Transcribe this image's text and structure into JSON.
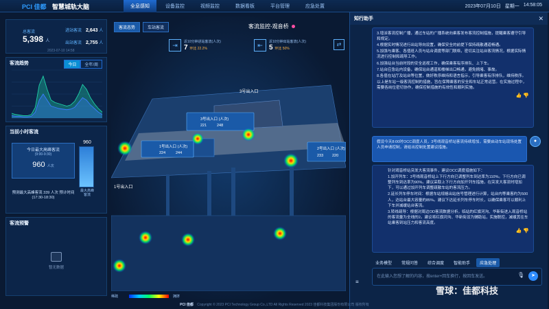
{
  "header": {
    "logo": "PCI 佳都",
    "title": "智慧城轨大脑",
    "nav": [
      "全息感知",
      "设备监控",
      "视频监控",
      "数据看板",
      "平台管理",
      "应急处置"
    ],
    "active_nav": 0,
    "datetime": "2023年07月10日",
    "weekday": "星期一",
    "time": "14:58:05"
  },
  "stats": {
    "total_label": "总客流",
    "total_value": "5,398",
    "total_unit": "人",
    "in_label": "进站客流",
    "in_value": "2,643",
    "in_unit": "人",
    "out_label": "出站客流",
    "out_value": "2,755",
    "out_unit": "人",
    "timestamp": "2023-07-10 14:58"
  },
  "trend": {
    "title": "客流趋势",
    "tab_today": "今日",
    "tab_all": "全年/周"
  },
  "peak": {
    "title": "当前小时客流",
    "box_title": "今日最大高峰客流",
    "box_time": "(9:00-9:30)",
    "value": "960",
    "unit": "人次",
    "note": "预测最大高峰客流 339 人次 预计时间(17:30-18:30)",
    "gauge_value": "960",
    "gauge_label": "最大高峰客流"
  },
  "warning": {
    "title": "客流预警",
    "empty_text": "暂无数据"
  },
  "center": {
    "btn_flow": "客流态势",
    "btn_station": "车站客流",
    "station_title": "客流监控-观音桥",
    "count1_label": "近10分钟进站客流(人次)",
    "count1_value": "7",
    "count1_change": "环比 22.2%",
    "count2_label": "近10分钟出站客流(人次)",
    "count2_value": "5",
    "count2_change": "环比 50%",
    "gate_labels": [
      "3号出入口",
      "1号出入口"
    ],
    "legend_low": "稀疏",
    "legend_high": "拥挤"
  },
  "gates": [
    {
      "title": "3号出入口 (人次)",
      "in": "221",
      "out": "248"
    },
    {
      "title": "1号出入口 (人次)",
      "in": "224",
      "out": "244"
    },
    {
      "title": "2号出入口 (人次)",
      "in": "233",
      "out": "220"
    }
  ],
  "assistant": {
    "name": "知行助手",
    "msg1": [
      "3.增派客流控制广播，通过车站的广播系统向乘客发布客流控制措施，提醒乘客遵守引导和规定。",
      "4.根据实时情况进行出站导向设置，确保安全的前提下保持疏散通道畅通。",
      "5.加强与乘客、各值班人员与站台调度等部门联络，密切关注站台客流情况，根据实际情况进行控制和疏导工作。",
      "6.加强站台当前时段的安全巡视工作，确保乘客有序排队、上下车。",
      "7.站台应急站内设备，确保站台通道和楼梯出口畅通，避免拥堵、事故。",
      "8.各值在站厅及站台等位置，做好秩序维持和语言指示，引导乘客有序排队，维持秩序。",
      "以上是车站一级客流控制的措施，旨在保障乘客的安全和车站正常运营。在实施过程中，需要各岗位密切协作，确保控制措施的有效性和顺利实施。"
    ],
    "msg2": "假设今天8:00时OCC调度人员，3号线观音桥站客流持续增加，需要启动车站现场处置人员申请控制，请给出控制处置建议措施。",
    "msg3": [
      "针对观音桥站突发大客流事件，建议OCC调度措施如下：",
      "1.加开列车：3号线观音桥站上下行方向已调整列车到达率为110%。下行方向已调整列车到达率为90%。建议采取上下行方向加开列车措施，在突发大客流时增加下，可以通过加开列车调整疏散车站的客流压力。",
      "2.延长列车停车时间：根据车站规格出站信号管理进行计算，站台内等乘客约为500人，达站台最大容量的85%。建议下达延长列车停车时长，以确保乘客可以顺利上下车并减缓站台客流。",
      "3.转线疏导：根据对周边OD客流数据分析，临站的红旗河沟、华新街进入观音桥站的客流量为全线的2。建议将红旗河沟、华新街设为辅助站，实施联控，减缓其往车站乘客到站压力和客流高度。"
    ],
    "feedback": "👍 👎",
    "tabs": [
      "业务模型",
      "常规问答",
      "综合调度",
      "智能助手",
      "应急处理"
    ],
    "active_tab": 4,
    "input_placeholder": "在此输入您想了解的内容，按enter+回车换行，按回车发送。"
  },
  "footer": {
    "brand": "PCI 佳都",
    "copyright": "Copyright © 2023 PCI Technology Group Co.,LTD All Rights Reserved 2023 佳都科技集团股份有限公司 版权所有"
  },
  "watermark": "雪球：佳都科技",
  "chart_data": {
    "type": "area",
    "title": "客流趋势",
    "series": [
      {
        "values": [
          8,
          6,
          5,
          4,
          4,
          6,
          18,
          55,
          70,
          48,
          30,
          26,
          24,
          22,
          20,
          22,
          28,
          40,
          56,
          48,
          34,
          24,
          16,
          10
        ]
      },
      {
        "values": [
          4,
          3,
          3,
          2,
          2,
          3,
          10,
          30,
          40,
          30,
          20,
          18,
          16,
          15,
          14,
          15,
          18,
          26,
          34,
          30,
          22,
          16,
          10,
          6
        ]
      }
    ],
    "colors": [
      "#1fd0a8",
      "#3b7dff"
    ],
    "ylim": [
      0,
      80
    ]
  }
}
